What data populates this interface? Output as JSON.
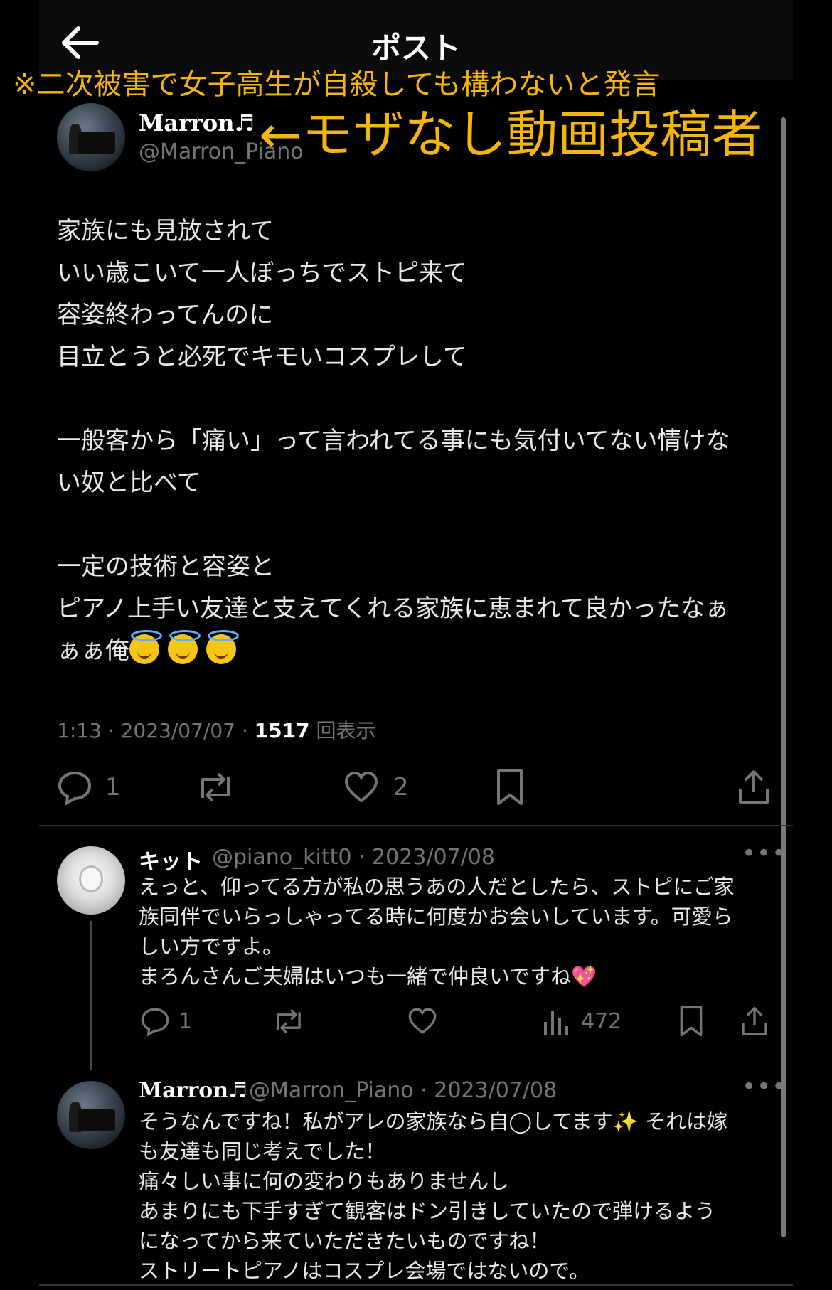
{
  "header": {
    "title": "ポスト",
    "warning": "※二次被害で女子高生が自殺しても構わないと発言"
  },
  "author": {
    "name": "Marron♬",
    "handle": "@Marron_Piano",
    "annotation": "←モザなし動画投稿者"
  },
  "post": {
    "lines": [
      "家族にも見放されて",
      "いい歳こいて一人ぼっちでストピ来て",
      "容姿終わってんのに",
      "目立とうと必死でキモいコスプレして",
      "",
      "一般客から「痛い」って言われてる事にも気付いてない情けな",
      "い奴と比べて",
      "",
      "一定の技術と容姿と",
      "ピアノ上手い友達と支えてくれる家族に恵まれて良かったなぁ"
    ],
    "last_line": "ぁぁ俺",
    "emoji": [
      "smiling-face-with-halo",
      "smiling-face-with-halo",
      "smiling-face-with-halo"
    ],
    "time": "1:13 · 2023/07/07 · ",
    "views_count": "1517",
    "views_label": " 回表示",
    "reply_count": "1",
    "like_count": "2"
  },
  "replies": [
    {
      "name": "キット",
      "handle": "@piano_kitt0 · 2023/07/08",
      "lines": [
        "えっと、仰ってる方が私の思うあの人だとしたら、ストピにご家",
        "族同伴でいらっしゃってる時に何度かお会いしています。可愛ら",
        "しい方ですよ。",
        "まろんさんご夫婦はいつも一緒で仲良いですね"
      ],
      "reply_count": "1",
      "view_count": "472"
    },
    {
      "name": "Marron♬",
      "handle": "@Marron_Piano · 2023/07/08",
      "line1": "そうなんですね！私がアレの家族なら自◯してます",
      "line1b": " それは嫁",
      "lines": [
        "も友達も同じ考えでした！",
        "痛々しい事に何の変わりもありませんし",
        "あまりにも下手すぎて観客はドン引きしていたので弾けるよう",
        "になってから来ていただきたいものですね！",
        "ストリートピアノはコスプレ会場ではないので。"
      ]
    }
  ],
  "colors": {
    "warning": "#f5b50a",
    "muted": "#71767b",
    "text": "#e7e9ea"
  }
}
